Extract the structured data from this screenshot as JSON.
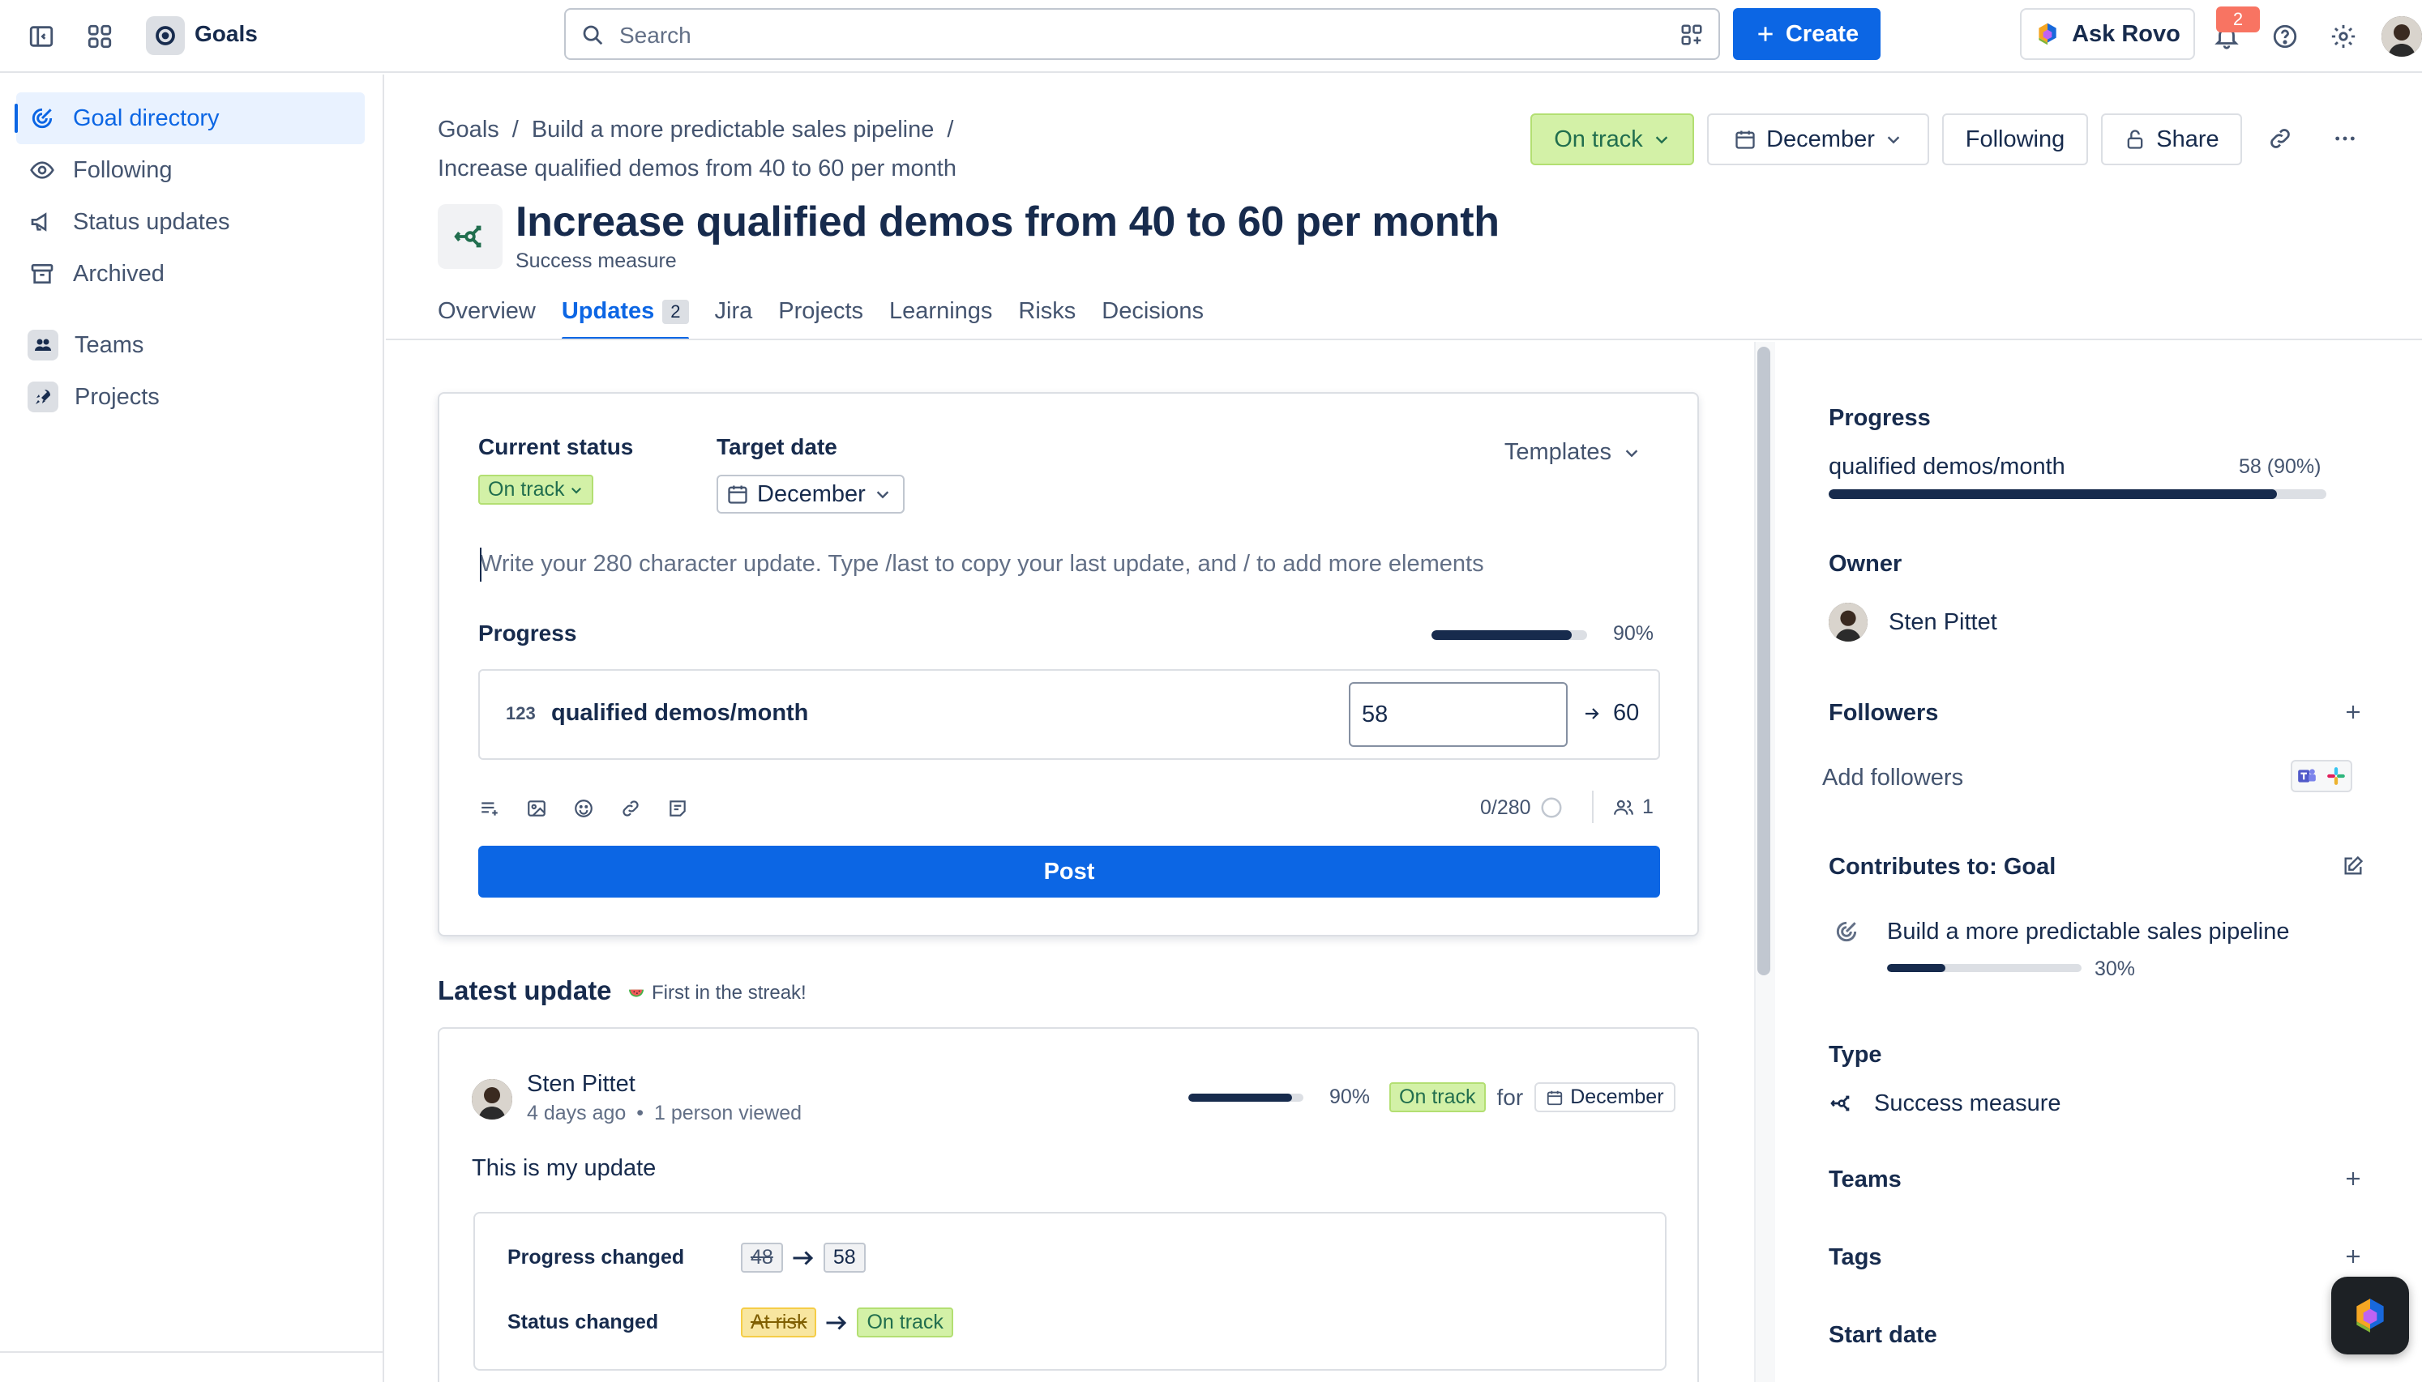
{
  "app": {
    "name": "Goals"
  },
  "topbar": {
    "search_placeholder": "Search",
    "create_label": "Create",
    "rovo_label": "Ask Rovo",
    "notification_count": "2"
  },
  "sidebar": {
    "items": [
      {
        "label": "Goal directory",
        "icon": "goal-icon",
        "active": true
      },
      {
        "label": "Following",
        "icon": "eye-icon"
      },
      {
        "label": "Status updates",
        "icon": "megaphone-icon"
      },
      {
        "label": "Archived",
        "icon": "archive-icon"
      },
      {
        "label": "Teams",
        "icon": "teams-icon"
      },
      {
        "label": "Projects",
        "icon": "rocket-icon"
      }
    ]
  },
  "breadcrumb": {
    "items": [
      "Goals",
      "Build a more predictable sales pipeline"
    ],
    "separator": "/",
    "current": "Increase qualified demos from 40 to 60 per month"
  },
  "header": {
    "status_label": "On track",
    "date_label": "December",
    "following_label": "Following",
    "share_label": "Share",
    "title": "Increase qualified demos from 40 to 60 per month",
    "subtitle": "Success measure"
  },
  "tabs": [
    {
      "label": "Overview"
    },
    {
      "label": "Updates",
      "count": "2",
      "active": true
    },
    {
      "label": "Jira"
    },
    {
      "label": "Projects"
    },
    {
      "label": "Learnings"
    },
    {
      "label": "Risks"
    },
    {
      "label": "Decisions"
    }
  ],
  "composer": {
    "current_status_label": "Current status",
    "current_status_value": "On track",
    "target_date_label": "Target date",
    "target_date_value": "December",
    "templates_label": "Templates",
    "placeholder": "Write your 280 character update. Type /last to copy your last update, and / to add more elements",
    "progress_label": "Progress",
    "progress_percent_text": "90%",
    "progress_fraction": 0.9,
    "metric_icon_text": "123",
    "metric_name": "qualified demos/month",
    "metric_value": "58",
    "metric_target": "60",
    "char_count": "0/280",
    "viewers_count": "1",
    "post_label": "Post"
  },
  "latest_update": {
    "title": "Latest update",
    "streak": "First in the streak!",
    "author": "Sten Pittet",
    "time": "4 days ago",
    "views": "1 person viewed",
    "progress_percent_text": "90%",
    "progress_fraction": 0.9,
    "status": "On track",
    "for_label": "for",
    "date": "December",
    "text": "This is my update",
    "progress_changed_label": "Progress changed",
    "progress_from": "48",
    "progress_to": "58",
    "status_changed_label": "Status changed",
    "status_from": "At risk",
    "status_to": "On track"
  },
  "right_panel": {
    "progress_heading": "Progress",
    "metric_name": "qualified demos/month",
    "metric_value": "58 (90%)",
    "progress_fraction": 0.9,
    "owner_heading": "Owner",
    "owner_name": "Sten Pittet",
    "followers_heading": "Followers",
    "add_followers": "Add followers",
    "contributes_heading": "Contributes to: Goal",
    "parent_goal": "Build a more predictable sales pipeline",
    "parent_percent": "30%",
    "parent_fraction": 0.3,
    "type_heading": "Type",
    "type_value": "Success measure",
    "teams_heading": "Teams",
    "tags_heading": "Tags",
    "start_date_heading": "Start date"
  },
  "colors": {
    "accent": "#0c66e4",
    "on_track_bg": "#d3f1a7",
    "at_risk_bg": "#f8e6a0"
  }
}
